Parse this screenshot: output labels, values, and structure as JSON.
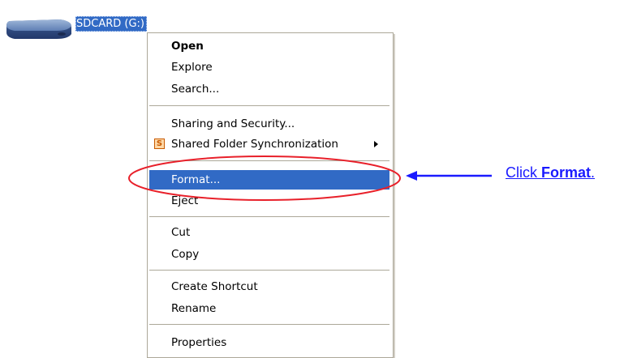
{
  "drive": {
    "label": "SDCARD (G:)",
    "icon": "removable-drive-icon"
  },
  "context_menu": {
    "items": {
      "open": "Open",
      "explore": "Explore",
      "search": "Search...",
      "sharing_security": "Sharing and Security...",
      "shared_folder_sync": "Shared Folder Synchronization",
      "format": "Format...",
      "eject": "Eject",
      "cut": "Cut",
      "copy": "Copy",
      "create_shortcut": "Create Shortcut",
      "rename": "Rename",
      "properties": "Properties"
    },
    "sync_icon_letter": "S",
    "highlighted_item": "format",
    "highlight_color": "#316ac5"
  },
  "annotation": {
    "prefix": "Click ",
    "emphasis": "Format",
    "suffix": ".",
    "color": "#1a1aff",
    "ellipse_color": "#e8202a"
  }
}
